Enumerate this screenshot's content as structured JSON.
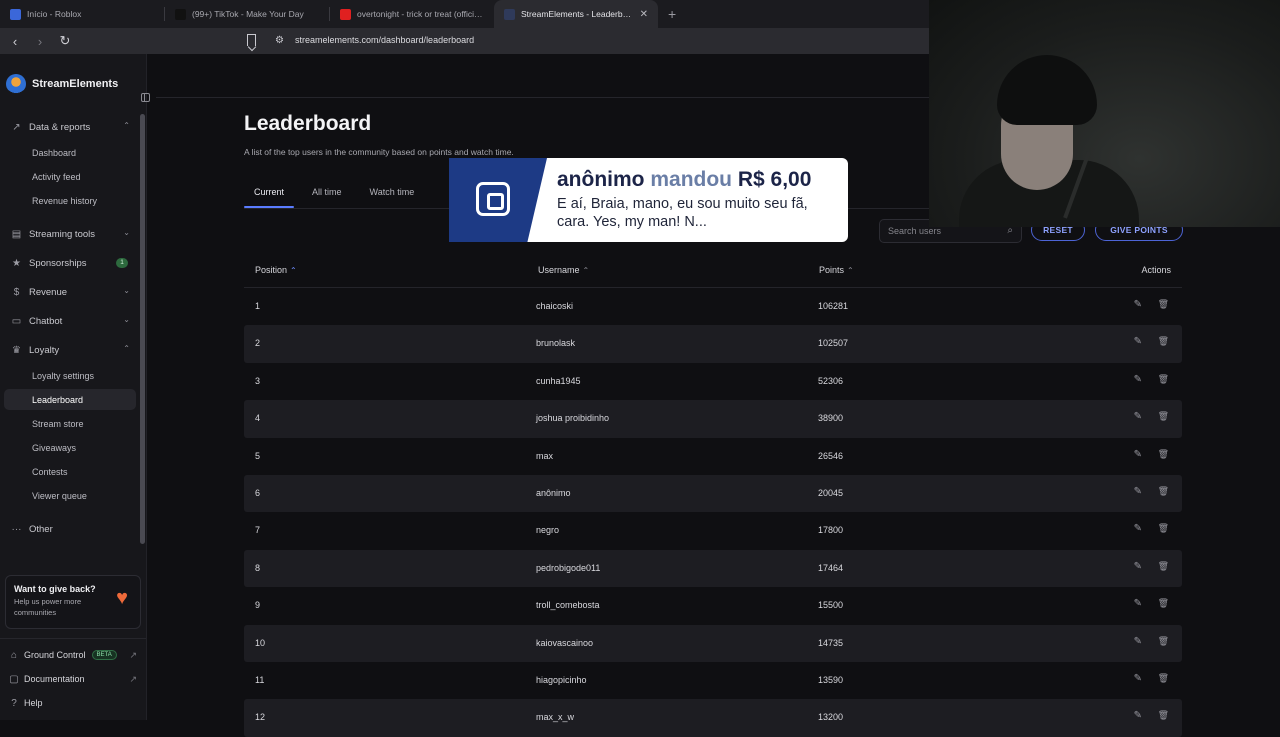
{
  "browser": {
    "tabs": [
      {
        "title": "Início - Roblox",
        "icon_color": "#3b67d9",
        "active": false
      },
      {
        "title": "(99+) TikTok - Make Your Day",
        "icon_color": "#111111",
        "active": false
      },
      {
        "title": "overtonight - trick or treat (official vi",
        "icon_color": "#e02020",
        "active": false
      },
      {
        "title": "StreamElements - Leaderboard",
        "icon_color": "#2f3a5a",
        "active": true
      }
    ],
    "url": "streamelements.com/dashboard/leaderboard"
  },
  "sidebar": {
    "brand": "StreamElements",
    "sections": [
      {
        "label": "Data & reports",
        "icon": "chart-icon",
        "expanded": true,
        "items": [
          "Dashboard",
          "Activity feed",
          "Revenue history"
        ]
      },
      {
        "label": "Streaming tools",
        "icon": "tools-icon",
        "expanded": false,
        "items": []
      },
      {
        "label": "Sponsorships",
        "icon": "star-icon",
        "badge": "1",
        "items": []
      },
      {
        "label": "Revenue",
        "icon": "dollar-icon",
        "expanded": false,
        "items": []
      },
      {
        "label": "Chatbot",
        "icon": "chat-icon",
        "expanded": false,
        "items": []
      },
      {
        "label": "Loyalty",
        "icon": "loyalty-icon",
        "expanded": true,
        "items": [
          "Loyalty settings",
          "Leaderboard",
          "Stream store",
          "Giveaways",
          "Contests",
          "Viewer queue"
        ]
      },
      {
        "label": "Other",
        "icon": "more-icon",
        "expanded": false,
        "items": []
      }
    ],
    "active_item": "Leaderboard",
    "promo": {
      "title": "Want to give back?",
      "text": "Help us power more communities"
    },
    "bottom": [
      {
        "label": "Ground Control",
        "badge": "BETA"
      },
      {
        "label": "Documentation"
      },
      {
        "label": "Help"
      }
    ]
  },
  "page": {
    "title": "Leaderboard",
    "subtitle": "A list of the top users in the community based on points and watch time.",
    "tabs": [
      "Current",
      "All time",
      "Watch time"
    ],
    "active_tab": "Current",
    "search_placeholder": "Search users",
    "reset_label": "RESET",
    "give_points_label": "GIVE POINTS"
  },
  "table": {
    "columns": [
      "Position",
      "Username",
      "Points",
      "Actions"
    ],
    "rows": [
      {
        "position": "1",
        "username": "chaicoski",
        "points": "106281"
      },
      {
        "position": "2",
        "username": "brunolask",
        "points": "102507"
      },
      {
        "position": "3",
        "username": "cunha1945",
        "points": "52306"
      },
      {
        "position": "4",
        "username": "joshua proibidinho",
        "points": "38900"
      },
      {
        "position": "5",
        "username": "max",
        "points": "26546"
      },
      {
        "position": "6",
        "username": "anônimo",
        "points": "20045"
      },
      {
        "position": "7",
        "username": "negro",
        "points": "17800"
      },
      {
        "position": "8",
        "username": "pedrobigode011",
        "points": "17464"
      },
      {
        "position": "9",
        "username": "troll_comebosta",
        "points": "15500"
      },
      {
        "position": "10",
        "username": "kaiovascainoo",
        "points": "14735"
      },
      {
        "position": "11",
        "username": "hiagopicinho",
        "points": "13590"
      },
      {
        "position": "12",
        "username": "max_x_w",
        "points": "13200"
      }
    ]
  },
  "alert": {
    "name": "anônimo",
    "verb": "mandou",
    "amount": "R$ 6,00",
    "message": "E aí, Braia, mano, eu sou muito seu fã, cara. Yes, my man! N..."
  }
}
